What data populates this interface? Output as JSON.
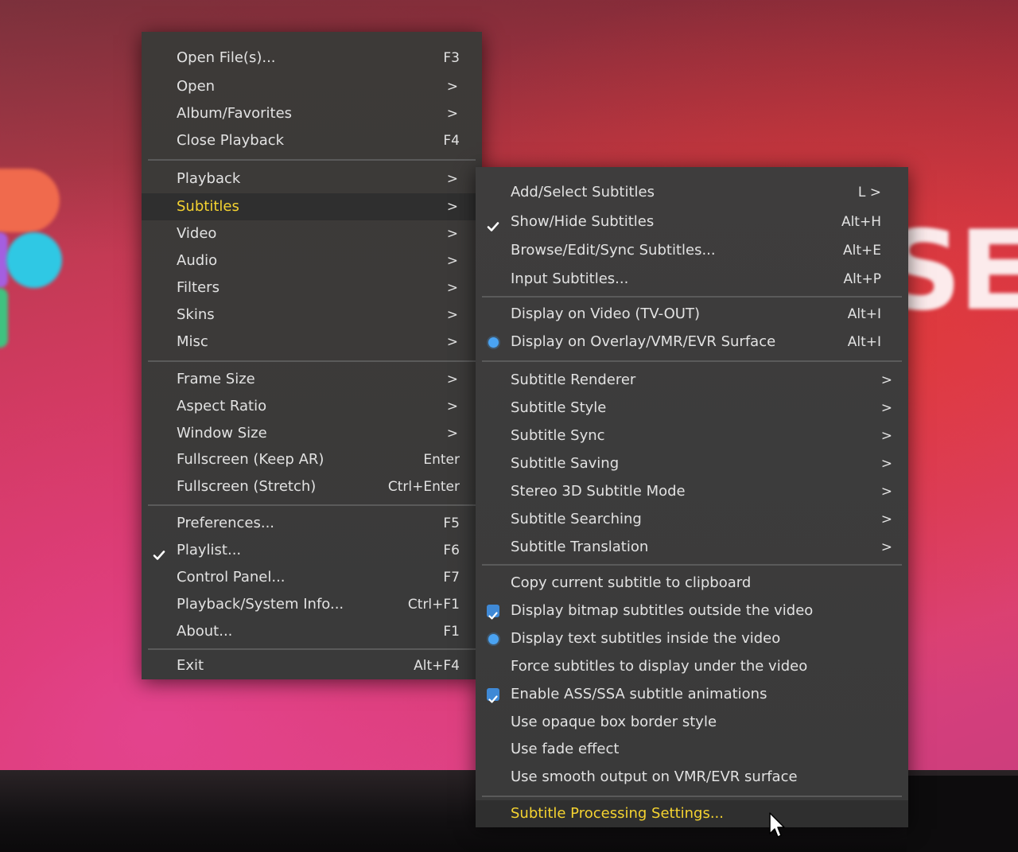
{
  "background": {
    "big_text": "SE"
  },
  "main_menu": {
    "items": [
      {
        "label": "Open File(s)...",
        "shortcut": "F3",
        "arrow": ""
      },
      {
        "label": "Open",
        "shortcut": "",
        "arrow": ">"
      },
      {
        "label": "Album/Favorites",
        "shortcut": "",
        "arrow": ">"
      },
      {
        "label": "Close Playback",
        "shortcut": "F4",
        "arrow": ""
      },
      {
        "label": "Playback",
        "shortcut": "",
        "arrow": ">"
      },
      {
        "label": "Subtitles",
        "shortcut": "",
        "arrow": ">"
      },
      {
        "label": "Video",
        "shortcut": "",
        "arrow": ">"
      },
      {
        "label": "Audio",
        "shortcut": "",
        "arrow": ">"
      },
      {
        "label": "Filters",
        "shortcut": "",
        "arrow": ">"
      },
      {
        "label": "Skins",
        "shortcut": "",
        "arrow": ">"
      },
      {
        "label": "Misc",
        "shortcut": "",
        "arrow": ">"
      },
      {
        "label": "Frame Size",
        "shortcut": "",
        "arrow": ">"
      },
      {
        "label": "Aspect Ratio",
        "shortcut": "",
        "arrow": ">"
      },
      {
        "label": "Window Size",
        "shortcut": "",
        "arrow": ">"
      },
      {
        "label": "Fullscreen (Keep AR)",
        "shortcut": "Enter",
        "arrow": ""
      },
      {
        "label": "Fullscreen (Stretch)",
        "shortcut": "Ctrl+Enter",
        "arrow": ""
      },
      {
        "label": "Preferences...",
        "shortcut": "F5",
        "arrow": ""
      },
      {
        "label": "Playlist...",
        "shortcut": "F6",
        "arrow": ""
      },
      {
        "label": "Control Panel...",
        "shortcut": "F7",
        "arrow": ""
      },
      {
        "label": "Playback/System Info...",
        "shortcut": "Ctrl+F1",
        "arrow": ""
      },
      {
        "label": "About...",
        "shortcut": "F1",
        "arrow": ""
      },
      {
        "label": "Exit",
        "shortcut": "Alt+F4",
        "arrow": ""
      }
    ]
  },
  "sub_menu": {
    "items": [
      {
        "label": "Add/Select Subtitles",
        "shortcut": "L >",
        "arrow": ""
      },
      {
        "label": "Show/Hide Subtitles",
        "shortcut": "Alt+H",
        "arrow": ""
      },
      {
        "label": "Browse/Edit/Sync Subtitles...",
        "shortcut": "Alt+E",
        "arrow": ""
      },
      {
        "label": "Input Subtitles...",
        "shortcut": "Alt+P",
        "arrow": ""
      },
      {
        "label": "Display on Video (TV-OUT)",
        "shortcut": "Alt+I",
        "arrow": ""
      },
      {
        "label": "Display on Overlay/VMR/EVR Surface",
        "shortcut": "Alt+I",
        "arrow": ""
      },
      {
        "label": "Subtitle Renderer",
        "shortcut": "",
        "arrow": ">"
      },
      {
        "label": "Subtitle Style",
        "shortcut": "",
        "arrow": ">"
      },
      {
        "label": "Subtitle Sync",
        "shortcut": "",
        "arrow": ">"
      },
      {
        "label": "Subtitle Saving",
        "shortcut": "",
        "arrow": ">"
      },
      {
        "label": "Stereo 3D Subtitle Mode",
        "shortcut": "",
        "arrow": ">"
      },
      {
        "label": "Subtitle Searching",
        "shortcut": "",
        "arrow": ">"
      },
      {
        "label": "Subtitle Translation",
        "shortcut": "",
        "arrow": ">"
      },
      {
        "label": "Copy current subtitle to clipboard",
        "shortcut": "",
        "arrow": ""
      },
      {
        "label": "Display bitmap subtitles outside the video",
        "shortcut": "",
        "arrow": ""
      },
      {
        "label": "Display text subtitles inside the video",
        "shortcut": "",
        "arrow": ""
      },
      {
        "label": "Force subtitles to display under the video",
        "shortcut": "",
        "arrow": ""
      },
      {
        "label": "Enable ASS/SSA subtitle animations",
        "shortcut": "",
        "arrow": ""
      },
      {
        "label": "Use opaque box border style",
        "shortcut": "",
        "arrow": ""
      },
      {
        "label": "Use fade effect",
        "shortcut": "",
        "arrow": ""
      },
      {
        "label": "Use smooth output on VMR/EVR surface",
        "shortcut": "",
        "arrow": ""
      },
      {
        "label": "Subtitle Processing Settings...",
        "shortcut": "",
        "arrow": ""
      }
    ]
  },
  "colors": {
    "menu_bg": "#3b3b3b",
    "highlight_text": "#f5d330",
    "checkbox_blue": "#3f89d6",
    "radio_blue": "#4aa3f2"
  }
}
